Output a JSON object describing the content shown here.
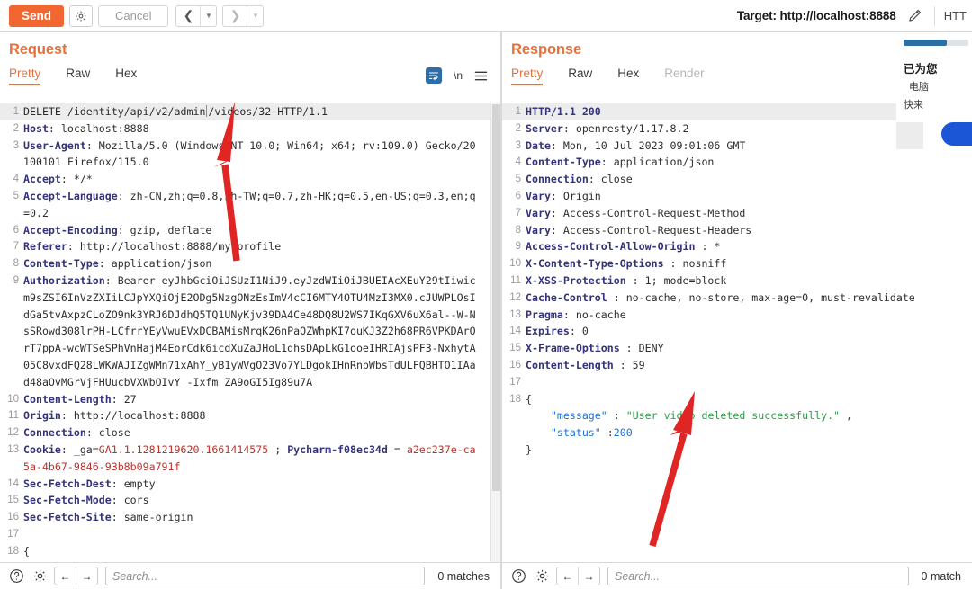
{
  "toolbar": {
    "send_label": "Send",
    "settings_icon": "gear-icon",
    "cancel_label": "Cancel",
    "prev_icon": "chevron-left-icon",
    "next_icon": "chevron-right-icon",
    "dropdown_icon": "caret-down-icon",
    "target_label": "Target: http://localhost:8888",
    "edit_icon": "pencil-icon",
    "http_label": "HTT"
  },
  "request": {
    "title": "Request",
    "tabs": [
      {
        "label": "Pretty",
        "active": true,
        "disabled": false
      },
      {
        "label": "Raw",
        "active": false,
        "disabled": false
      },
      {
        "label": "Hex",
        "active": false,
        "disabled": false
      }
    ],
    "tools": {
      "wrap_icon": "text-wrap-icon",
      "newline_label": "\\n",
      "menu_icon": "hamburger-menu-icon"
    },
    "lines": [
      {
        "n": "1",
        "hl": true,
        "parts": [
          {
            "t": "DELETE /identity/api/v2/admin",
            "c": "plain"
          },
          {
            "t": "",
            "c": "caret"
          },
          {
            "t": "/videos/32 HTTP/1.1",
            "c": "plain"
          }
        ]
      },
      {
        "n": "2",
        "parts": [
          {
            "t": "Host",
            "c": "hdr-name"
          },
          {
            "t": ": localhost:8888",
            "c": "hdr-val"
          }
        ]
      },
      {
        "n": "3",
        "parts": [
          {
            "t": "User-Agent",
            "c": "hdr-name"
          },
          {
            "t": ": Mozilla/5.0 (Windows NT 10.0; Win64; x64; rv:109.0) Gecko/20100101 Firefox/115.0",
            "c": "hdr-val"
          }
        ]
      },
      {
        "n": "4",
        "parts": [
          {
            "t": "Accept",
            "c": "hdr-name"
          },
          {
            "t": ": */*",
            "c": "hdr-val"
          }
        ]
      },
      {
        "n": "5",
        "parts": [
          {
            "t": "Accept-Language",
            "c": "hdr-name"
          },
          {
            "t": ": zh-CN,zh;q=0.8,zh-TW;q=0.7,zh-HK;q=0.5,en-US;q=0.3,en;q=0.2",
            "c": "hdr-val"
          }
        ]
      },
      {
        "n": "6",
        "parts": [
          {
            "t": "Accept-Encoding",
            "c": "hdr-name"
          },
          {
            "t": ": gzip, deflate",
            "c": "hdr-val"
          }
        ]
      },
      {
        "n": "7",
        "parts": [
          {
            "t": "Referer",
            "c": "hdr-name"
          },
          {
            "t": ": http://localhost:8888/my-profile",
            "c": "hdr-val"
          }
        ]
      },
      {
        "n": "8",
        "parts": [
          {
            "t": "Content-Type",
            "c": "hdr-name"
          },
          {
            "t": ": application/json",
            "c": "hdr-val"
          }
        ]
      },
      {
        "n": "9",
        "parts": [
          {
            "t": "Authorization",
            "c": "hdr-name"
          },
          {
            "t": ": Bearer eyJhbGciOiJSUzI1NiJ9.eyJzdWIiOiJBUEIAcXEuY29tIiwicm9sZSI6InVzZXIiLCJpYXQiOjE2ODg5NzgONzEsImV4cCI6MTY4OTU4MzI3MX0.cJUWPLOsIdGa5tvAxpzCLoZO9nk3YRJ6DJdhQ5TQ1UNyKjv39DA4Ce48DQ8U2WS7IKqGXV6uX6al--W-NsSRowd308lrPH-LCfrrYEyVwuEVxDCBAMisMrqK26nPaOZWhpKI7ouKJ3Z2h68PR6VPKDArOrT7ppA-wcWTSeSPhVnHajM4EorCdk6icdXuZaJHoL1dhsDApLkG1ooeIHRIAjsPF3-NxhytA05C8vxdFQ28LWKWAJIZgWMn71xAhY_yB1yWVgO23Vo7YLDgokIHnRnbWbsTdULFQBHTO1IAad48aOvMGrVjFHUucbVXWbOIvY_-Ixfm ZA9oGI5Ig89u7A",
            "c": "hdr-val"
          }
        ]
      },
      {
        "n": "10",
        "parts": [
          {
            "t": "Content-Length",
            "c": "hdr-name"
          },
          {
            "t": ": 27",
            "c": "hdr-val"
          }
        ]
      },
      {
        "n": "11",
        "parts": [
          {
            "t": "Origin",
            "c": "hdr-name"
          },
          {
            "t": ": http://localhost:8888",
            "c": "hdr-val"
          }
        ]
      },
      {
        "n": "12",
        "parts": [
          {
            "t": "Connection",
            "c": "hdr-name"
          },
          {
            "t": ": close",
            "c": "hdr-val"
          }
        ]
      },
      {
        "n": "13",
        "parts": [
          {
            "t": "Cookie",
            "c": "hdr-name"
          },
          {
            "t": ": _ga=",
            "c": "hdr-val"
          },
          {
            "t": "GA1.1.1281219620.1661414575",
            "c": "tok-red"
          },
          {
            "t": " ; ",
            "c": "hdr-val"
          },
          {
            "t": "Pycharm-f08ec34d",
            "c": "hdr-name"
          },
          {
            "t": " = ",
            "c": "hdr-val"
          },
          {
            "t": "a2ec237e-ca5a-4b67-9846-93b8b09a791f",
            "c": "tok-red"
          }
        ]
      },
      {
        "n": "14",
        "parts": [
          {
            "t": "Sec-Fetch-Dest",
            "c": "hdr-name"
          },
          {
            "t": ": empty",
            "c": "hdr-val"
          }
        ]
      },
      {
        "n": "15",
        "parts": [
          {
            "t": "Sec-Fetch-Mode",
            "c": "hdr-name"
          },
          {
            "t": ": cors",
            "c": "hdr-val"
          }
        ]
      },
      {
        "n": "16",
        "parts": [
          {
            "t": "Sec-Fetch-Site",
            "c": "hdr-name"
          },
          {
            "t": ": same-origin",
            "c": "hdr-val"
          }
        ]
      },
      {
        "n": "17",
        "parts": [
          {
            "t": "",
            "c": "plain"
          }
        ]
      },
      {
        "n": "18",
        "parts": [
          {
            "t": "{",
            "c": "tok-punct"
          }
        ]
      }
    ],
    "statusbar": {
      "help_icon": "help-circle-icon",
      "gear_icon": "gear-icon",
      "back_icon": "arrow-left-icon",
      "forward_icon": "arrow-right-icon",
      "search_placeholder": "Search...",
      "matches_label": "0 matches"
    }
  },
  "response": {
    "title": "Response",
    "tabs": [
      {
        "label": "Pretty",
        "active": true,
        "disabled": false
      },
      {
        "label": "Raw",
        "active": false,
        "disabled": false
      },
      {
        "label": "Hex",
        "active": false,
        "disabled": false
      },
      {
        "label": "Render",
        "active": false,
        "disabled": true
      }
    ],
    "lines": [
      {
        "n": "1",
        "hl": true,
        "parts": [
          {
            "t": "HTTP/1.1 200",
            "c": "hdr-name"
          }
        ]
      },
      {
        "n": "2",
        "parts": [
          {
            "t": "Server",
            "c": "hdr-name"
          },
          {
            "t": ": openresty/1.17.8.2",
            "c": "hdr-val"
          }
        ]
      },
      {
        "n": "3",
        "parts": [
          {
            "t": "Date",
            "c": "hdr-name"
          },
          {
            "t": ": Mon, 10 Jul 2023 09:01:06 GMT",
            "c": "hdr-val"
          }
        ]
      },
      {
        "n": "4",
        "parts": [
          {
            "t": "Content-Type",
            "c": "hdr-name"
          },
          {
            "t": ": application/json",
            "c": "hdr-val"
          }
        ]
      },
      {
        "n": "5",
        "parts": [
          {
            "t": "Connection",
            "c": "hdr-name"
          },
          {
            "t": ": close",
            "c": "hdr-val"
          }
        ]
      },
      {
        "n": "6",
        "parts": [
          {
            "t": "Vary",
            "c": "hdr-name"
          },
          {
            "t": ": Origin",
            "c": "hdr-val"
          }
        ]
      },
      {
        "n": "7",
        "parts": [
          {
            "t": "Vary",
            "c": "hdr-name"
          },
          {
            "t": ": Access-Control-Request-Method",
            "c": "hdr-val"
          }
        ]
      },
      {
        "n": "8",
        "parts": [
          {
            "t": "Vary",
            "c": "hdr-name"
          },
          {
            "t": ": Access-Control-Request-Headers",
            "c": "hdr-val"
          }
        ]
      },
      {
        "n": "9",
        "parts": [
          {
            "t": "Access-Control-Allow-Origin",
            "c": "hdr-name"
          },
          {
            "t": " : *",
            "c": "hdr-val"
          }
        ]
      },
      {
        "n": "10",
        "parts": [
          {
            "t": "X-Content-Type-Options",
            "c": "hdr-name"
          },
          {
            "t": " : nosniff",
            "c": "hdr-val"
          }
        ]
      },
      {
        "n": "11",
        "parts": [
          {
            "t": "X-XSS-Protection",
            "c": "hdr-name"
          },
          {
            "t": " : 1; mode=block",
            "c": "hdr-val"
          }
        ]
      },
      {
        "n": "12",
        "parts": [
          {
            "t": "Cache-Control",
            "c": "hdr-name"
          },
          {
            "t": " : no-cache, no-store, max-age=0, must-revalidate",
            "c": "hdr-val"
          }
        ]
      },
      {
        "n": "13",
        "parts": [
          {
            "t": "Pragma",
            "c": "hdr-name"
          },
          {
            "t": ": no-cache",
            "c": "hdr-val"
          }
        ]
      },
      {
        "n": "14",
        "parts": [
          {
            "t": "Expires",
            "c": "hdr-name"
          },
          {
            "t": ": 0",
            "c": "hdr-val"
          }
        ]
      },
      {
        "n": "15",
        "parts": [
          {
            "t": "X-Frame-Options",
            "c": "hdr-name"
          },
          {
            "t": " : DENY",
            "c": "hdr-val"
          }
        ]
      },
      {
        "n": "16",
        "parts": [
          {
            "t": "Content-Length",
            "c": "hdr-name"
          },
          {
            "t": " : 59",
            "c": "hdr-val"
          }
        ]
      },
      {
        "n": "17",
        "parts": [
          {
            "t": "",
            "c": "plain"
          }
        ]
      },
      {
        "n": "18",
        "parts": [
          {
            "t": "{",
            "c": "tok-punct"
          }
        ]
      },
      {
        "n": "",
        "parts": [
          {
            "t": "    ",
            "c": "plain"
          },
          {
            "t": "\"message\"",
            "c": "tok-key"
          },
          {
            "t": " : ",
            "c": "tok-punct"
          },
          {
            "t": "\"User video deleted successfully.\"",
            "c": "tok-str"
          },
          {
            "t": " ,",
            "c": "tok-punct"
          }
        ]
      },
      {
        "n": "",
        "parts": [
          {
            "t": "    ",
            "c": "plain"
          },
          {
            "t": "\"status\"",
            "c": "tok-key"
          },
          {
            "t": " :",
            "c": "tok-punct"
          },
          {
            "t": "200",
            "c": "tok-num"
          }
        ]
      },
      {
        "n": "",
        "parts": [
          {
            "t": "}",
            "c": "tok-punct"
          }
        ]
      }
    ],
    "statusbar": {
      "help_icon": "help-circle-icon",
      "gear_icon": "gear-icon",
      "back_icon": "arrow-left-icon",
      "forward_icon": "arrow-right-icon",
      "search_placeholder": "Search...",
      "matches_label": "0 match"
    }
  },
  "ad_overlay": {
    "title": "已为您",
    "line1": "电脑",
    "line2": "快来",
    "progress_percent": 66
  },
  "annotations": {
    "arrow_request_color": "#e02525",
    "arrow_response_color": "#e02525"
  },
  "colors": {
    "accent": "#f26632",
    "panel_title": "#e8703a",
    "code_header": "#33337a",
    "json_string": "#2e9b46",
    "json_key": "#1f6fd0",
    "cookie_value": "#b8342c",
    "highlight_row": "#ececec"
  }
}
